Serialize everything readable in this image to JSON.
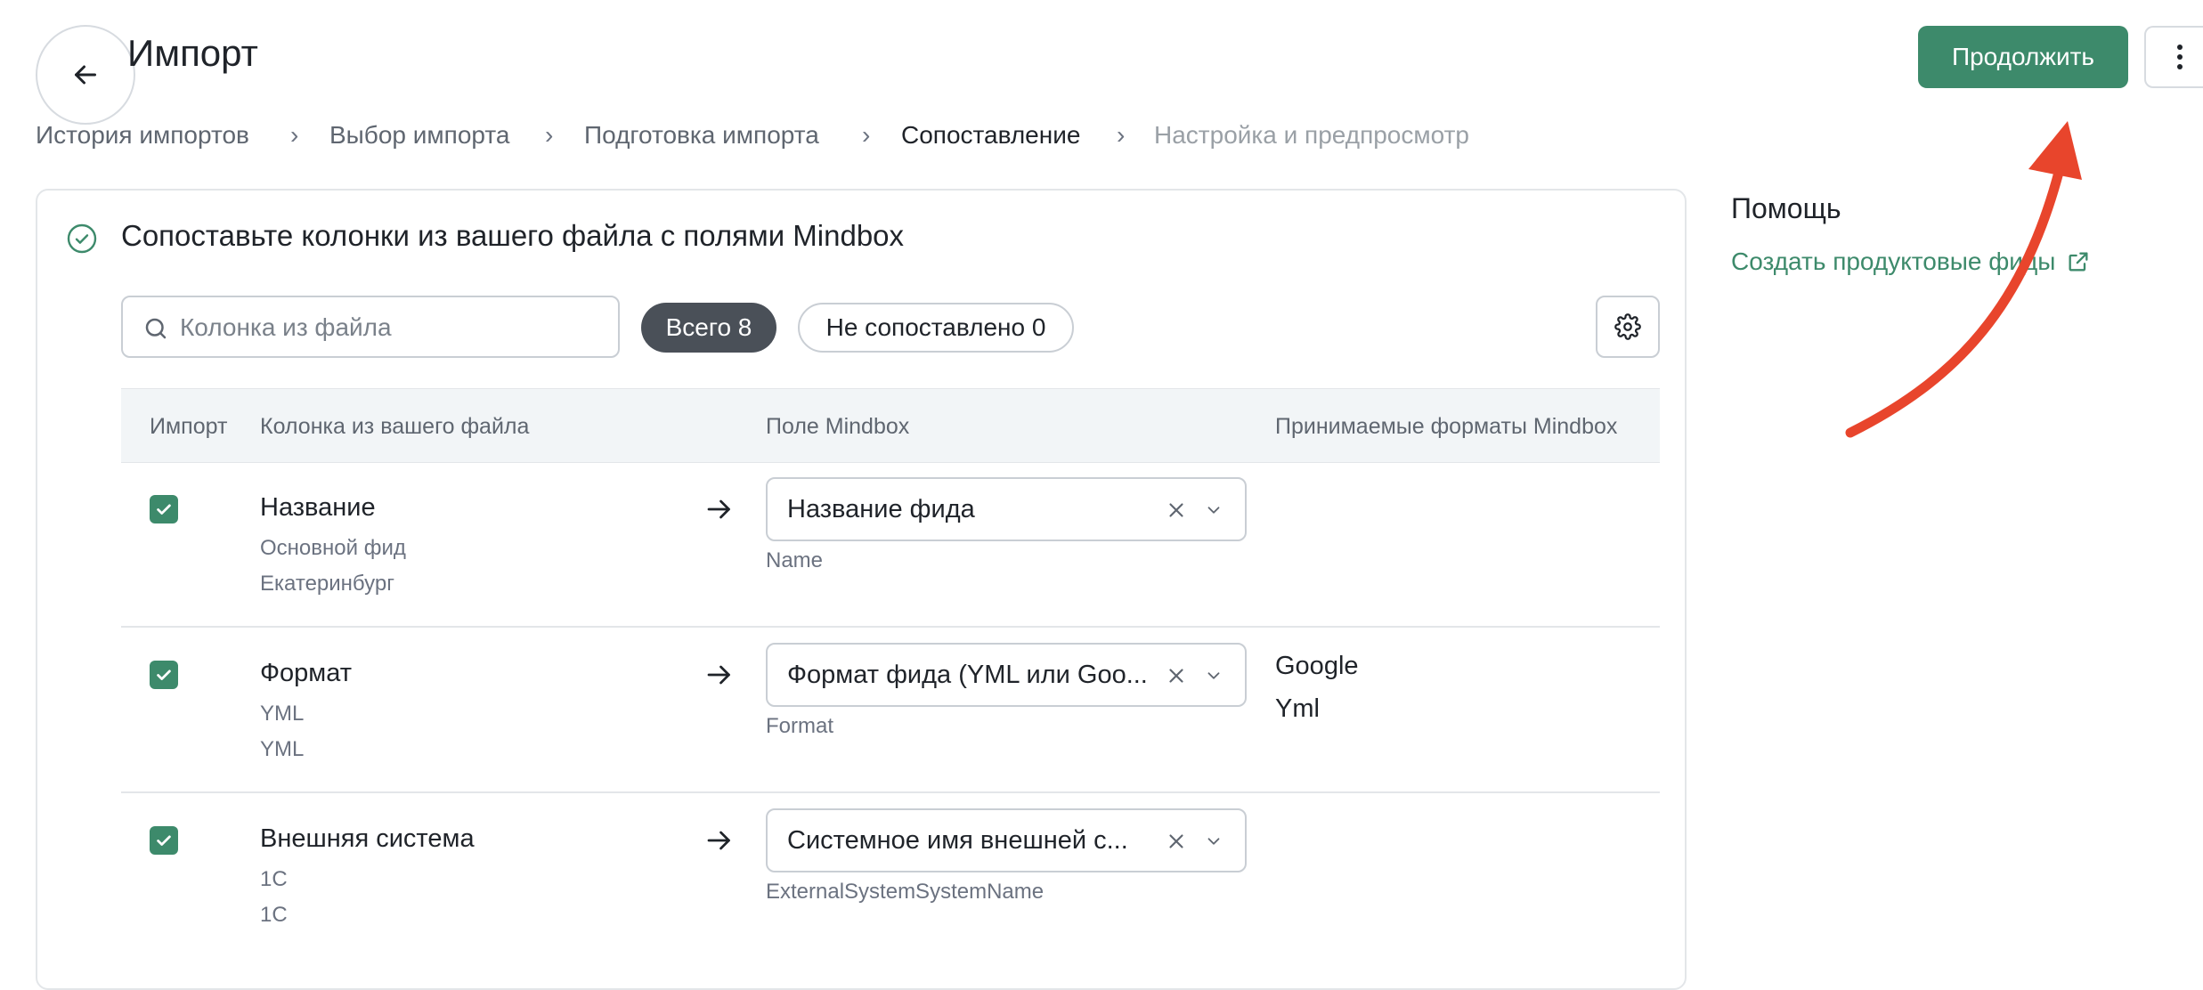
{
  "header": {
    "title": "Импорт",
    "continue_label": "Продолжить"
  },
  "breadcrumbs": [
    {
      "label": "История импортов"
    },
    {
      "label": "Выбор импорта"
    },
    {
      "label": "Подготовка импорта"
    },
    {
      "label": "Сопоставление"
    },
    {
      "label": "Настройка и предпросмотр"
    }
  ],
  "card": {
    "title": "Сопоставьте колонки из вашего файла с полями Mindbox",
    "search_placeholder": "Колонка из файла",
    "chip_all": "Всего 8",
    "chip_unmatched": "Не сопоставлено 0"
  },
  "table": {
    "headers": [
      "Импорт",
      "Колонка из вашего файла",
      "Поле Mindbox",
      "Принимаемые форматы Mindbox"
    ],
    "rows": [
      {
        "column": "Название",
        "sample1": "Основной фид",
        "sample2": "Екатеринбург",
        "field": "Название фида",
        "code": "Name",
        "formats": []
      },
      {
        "column": "Формат",
        "sample1": "YML",
        "sample2": "YML",
        "field": "Формат фида (YML или Goo...",
        "code": "Format",
        "formats": [
          "Google",
          "Yml"
        ]
      },
      {
        "column": "Внешняя система",
        "sample1": "1С",
        "sample2": "1С",
        "field": "Системное имя внешней с...",
        "code": "ExternalSystemSystemName",
        "formats": []
      }
    ]
  },
  "help": {
    "title": "Помощь",
    "link": "Создать продуктовые фиды"
  },
  "colors": {
    "accent": "#3d8a6b",
    "annotation_arrow": "#e8452c"
  }
}
